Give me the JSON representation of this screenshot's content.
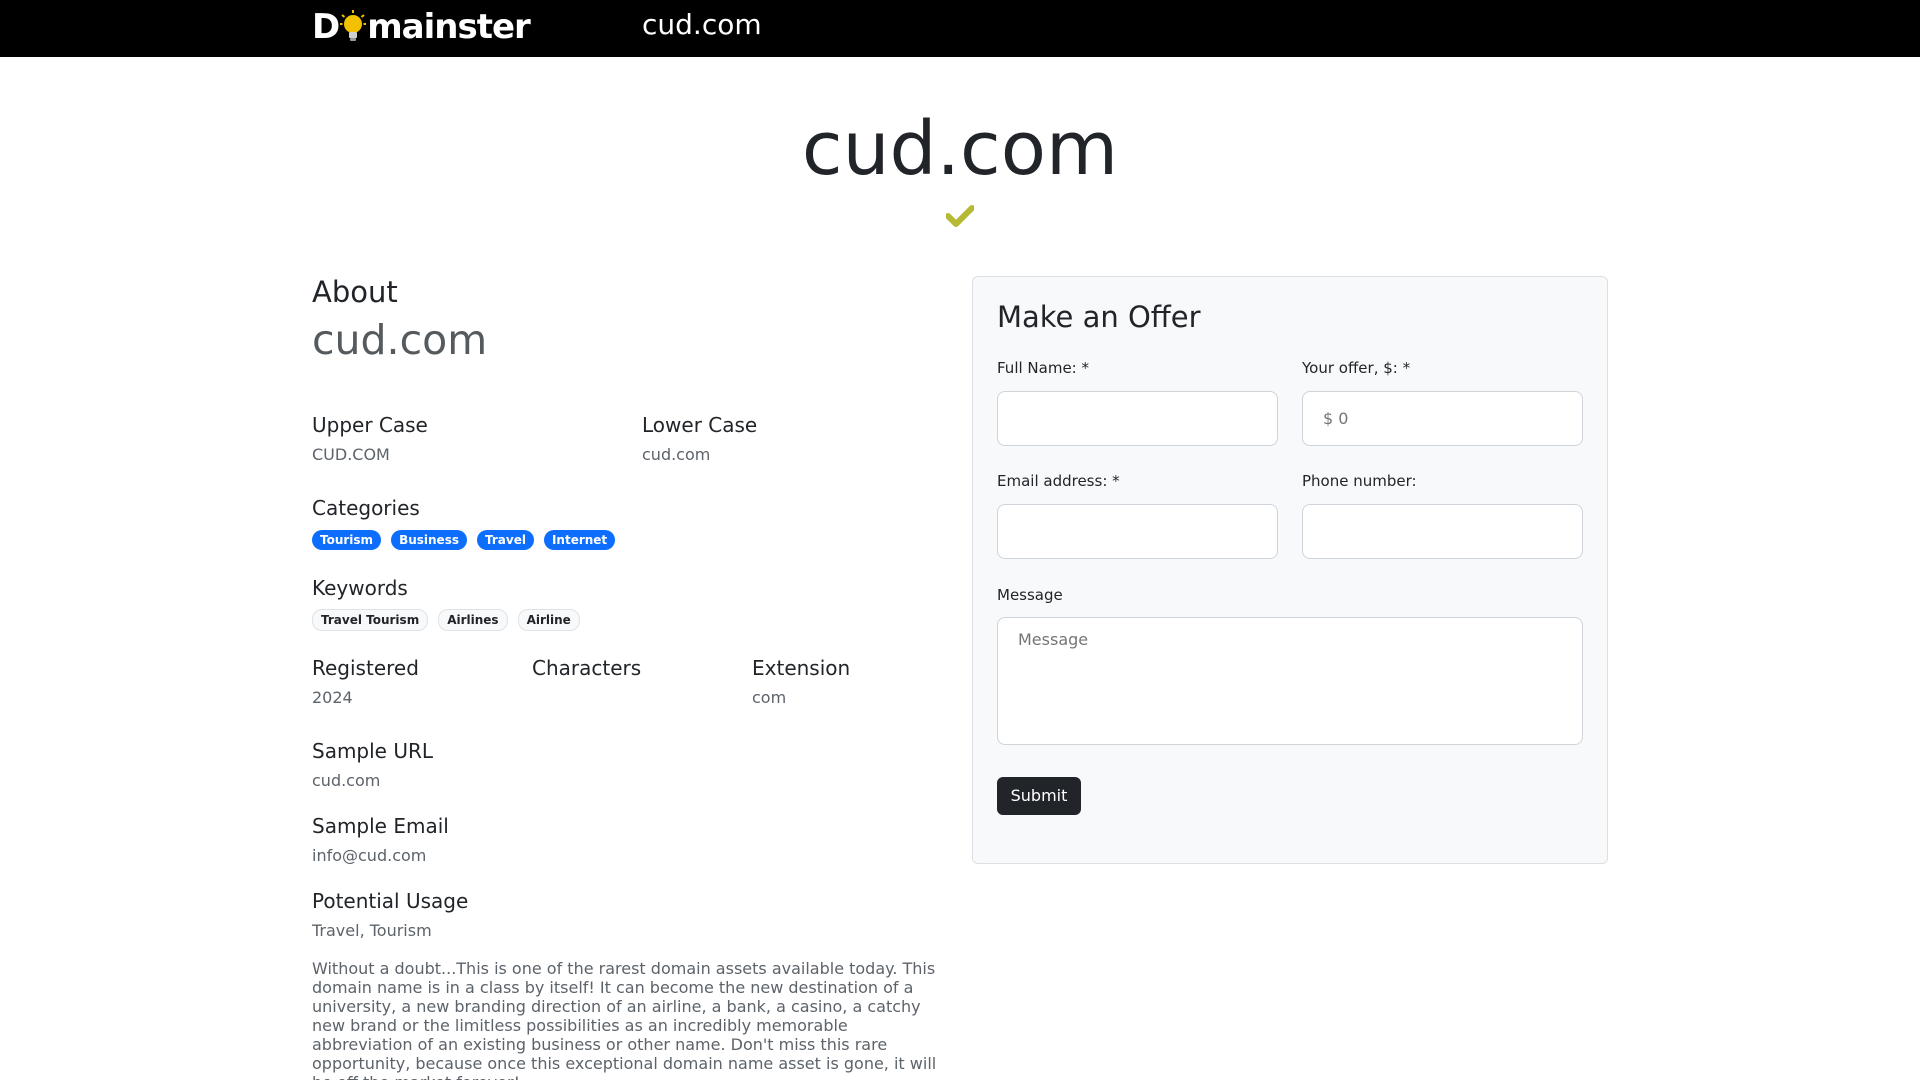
{
  "header": {
    "logo_text_left": "D",
    "logo_text_right": "mainster",
    "domain": "cud.com"
  },
  "hero": {
    "title": "cud.com",
    "check_icon": "check-icon",
    "check_color": "#b5b934"
  },
  "about": {
    "heading": "About",
    "domain": "cud.com"
  },
  "details": {
    "upper_case_label": "Upper Case",
    "upper_case_value": "CUD.COM",
    "lower_case_label": "Lower Case",
    "lower_case_value": "cud.com",
    "categories_label": "Categories",
    "categories": [
      "Tourism",
      "Business",
      "Travel",
      "Internet"
    ],
    "keywords_label": "Keywords",
    "keywords": [
      "Travel Tourism",
      "Airlines",
      "Airline"
    ],
    "registered_label": "Registered",
    "registered_value": "2024",
    "characters_label": "Characters",
    "extension_label": "Extension",
    "extension_value": "com",
    "sample_url_label": "Sample URL",
    "sample_url_value": "cud.com",
    "sample_email_label": "Sample Email",
    "sample_email_value": "info@cud.com",
    "potential_usage_label": "Potential Usage",
    "potential_usage_value": "Travel, Tourism",
    "description": "Without a doubt...This is one of the rarest domain assets available today. This domain name is in a class by itself! It can become the new destination of a university, a new branding direction of an airline, a bank, a casino, a catchy new brand or the limitless possibilities as an incredibly memorable abbreviation of an existing business or other name. Don't miss this rare opportunity, because once this exceptional domain name asset is gone, it will be off the market forever!"
  },
  "offer_form": {
    "title": "Make an Offer",
    "full_name_label": "Full Name: *",
    "full_name_value": "",
    "offer_label": "Your offer, $: *",
    "offer_placeholder": "$ 0",
    "email_label": "Email address: *",
    "email_value": "",
    "phone_label": "Phone number:",
    "phone_value": "",
    "message_label": "Message",
    "message_placeholder": "Message",
    "submit_label": "Submit"
  },
  "colors": {
    "accent": "#0d6efd",
    "dark": "#212529",
    "topbar": "#000000",
    "check": "#b5b934"
  }
}
